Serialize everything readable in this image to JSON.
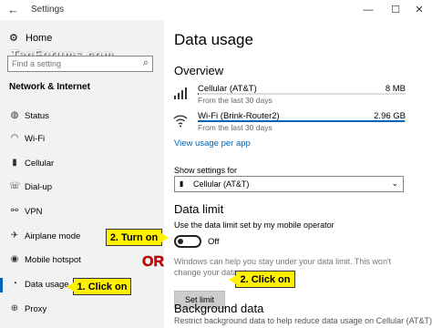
{
  "window": {
    "title": "Settings",
    "back_glyph": "←",
    "minimize_glyph": "—",
    "maximize_glyph": "☐",
    "close_glyph": "✕"
  },
  "sidebar": {
    "home_label": "Home",
    "home_icon": "gear-icon",
    "watermark": "TenForums.com",
    "search_placeholder": "Find a setting",
    "search_icon": "search-icon",
    "section_title": "Network & Internet",
    "items": [
      {
        "label": "Status",
        "icon": "globe-icon",
        "glyph": "◍"
      },
      {
        "label": "Wi-Fi",
        "icon": "wifi-icon",
        "glyph": "◠"
      },
      {
        "label": "Cellular",
        "icon": "cellular-icon",
        "glyph": "▮"
      },
      {
        "label": "Dial-up",
        "icon": "phone-icon",
        "glyph": "☏"
      },
      {
        "label": "VPN",
        "icon": "vpn-icon",
        "glyph": "⚯"
      },
      {
        "label": "Airplane mode",
        "icon": "airplane-icon",
        "glyph": "✈"
      },
      {
        "label": "Mobile hotspot",
        "icon": "hotspot-icon",
        "glyph": "◉"
      },
      {
        "label": "Data usage",
        "icon": "data-usage-icon",
        "glyph": "◔",
        "active": true
      },
      {
        "label": "Proxy",
        "icon": "proxy-icon",
        "glyph": "⊕"
      }
    ]
  },
  "main": {
    "title": "Data usage",
    "overview_title": "Overview",
    "usage": [
      {
        "name": "Cellular (AT&T)",
        "period": "From the last 30 days",
        "amount": "8 MB",
        "icon": "cellular-signal-icon",
        "fraction": 0.003
      },
      {
        "name": "Wi-Fi (Brink-Router2)",
        "period": "From the last 30 days",
        "amount": "2.96 GB",
        "icon": "wifi-signal-icon",
        "fraction": 0.997
      }
    ],
    "view_usage_link": "View usage per app",
    "show_settings_label": "Show settings for",
    "selected_network": "Cellular (AT&T)",
    "data_limit_title": "Data limit",
    "operator_toggle_label": "Use the data limit set by my mobile operator",
    "toggle_state": "Off",
    "description": "Windows can help you stay under your data limit. This won't change your data plan.",
    "set_limit_button": "Set limit",
    "background_data_title": "Background data",
    "background_desc": "Restrict background data to help reduce data usage on Cellular (AT&T)"
  },
  "callouts": {
    "turn_on": "2. Turn on",
    "click_on_left": "1. Click on",
    "click_on_right": "2. Click on",
    "or_text": "OR"
  },
  "colors": {
    "accent": "#0063b1",
    "callout": "#fff200",
    "or_text": "#e00000",
    "sidebar_bg": "#f2f2f2"
  }
}
